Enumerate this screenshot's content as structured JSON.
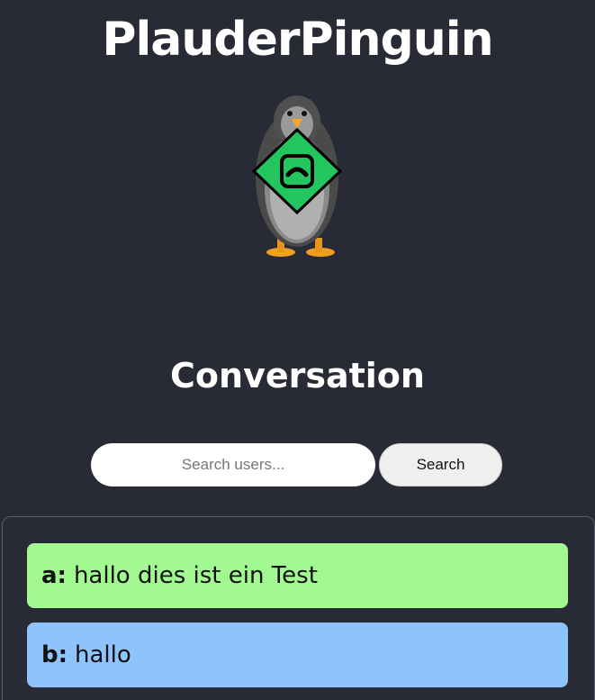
{
  "app": {
    "title": "PlauderPinguin",
    "logo_icon": "penguin-phone-icon"
  },
  "main": {
    "heading": "Conversation"
  },
  "search": {
    "placeholder": "Search users...",
    "value": "",
    "button_label": "Search"
  },
  "messages": [
    {
      "sender": "a:",
      "text": "hallo dies ist ein Test",
      "color": "#a2f991"
    },
    {
      "sender": "b:",
      "text": "hallo",
      "color": "#8fc3fb"
    }
  ],
  "colors": {
    "background": "#282b35",
    "logo_badge": "#22c55e"
  }
}
